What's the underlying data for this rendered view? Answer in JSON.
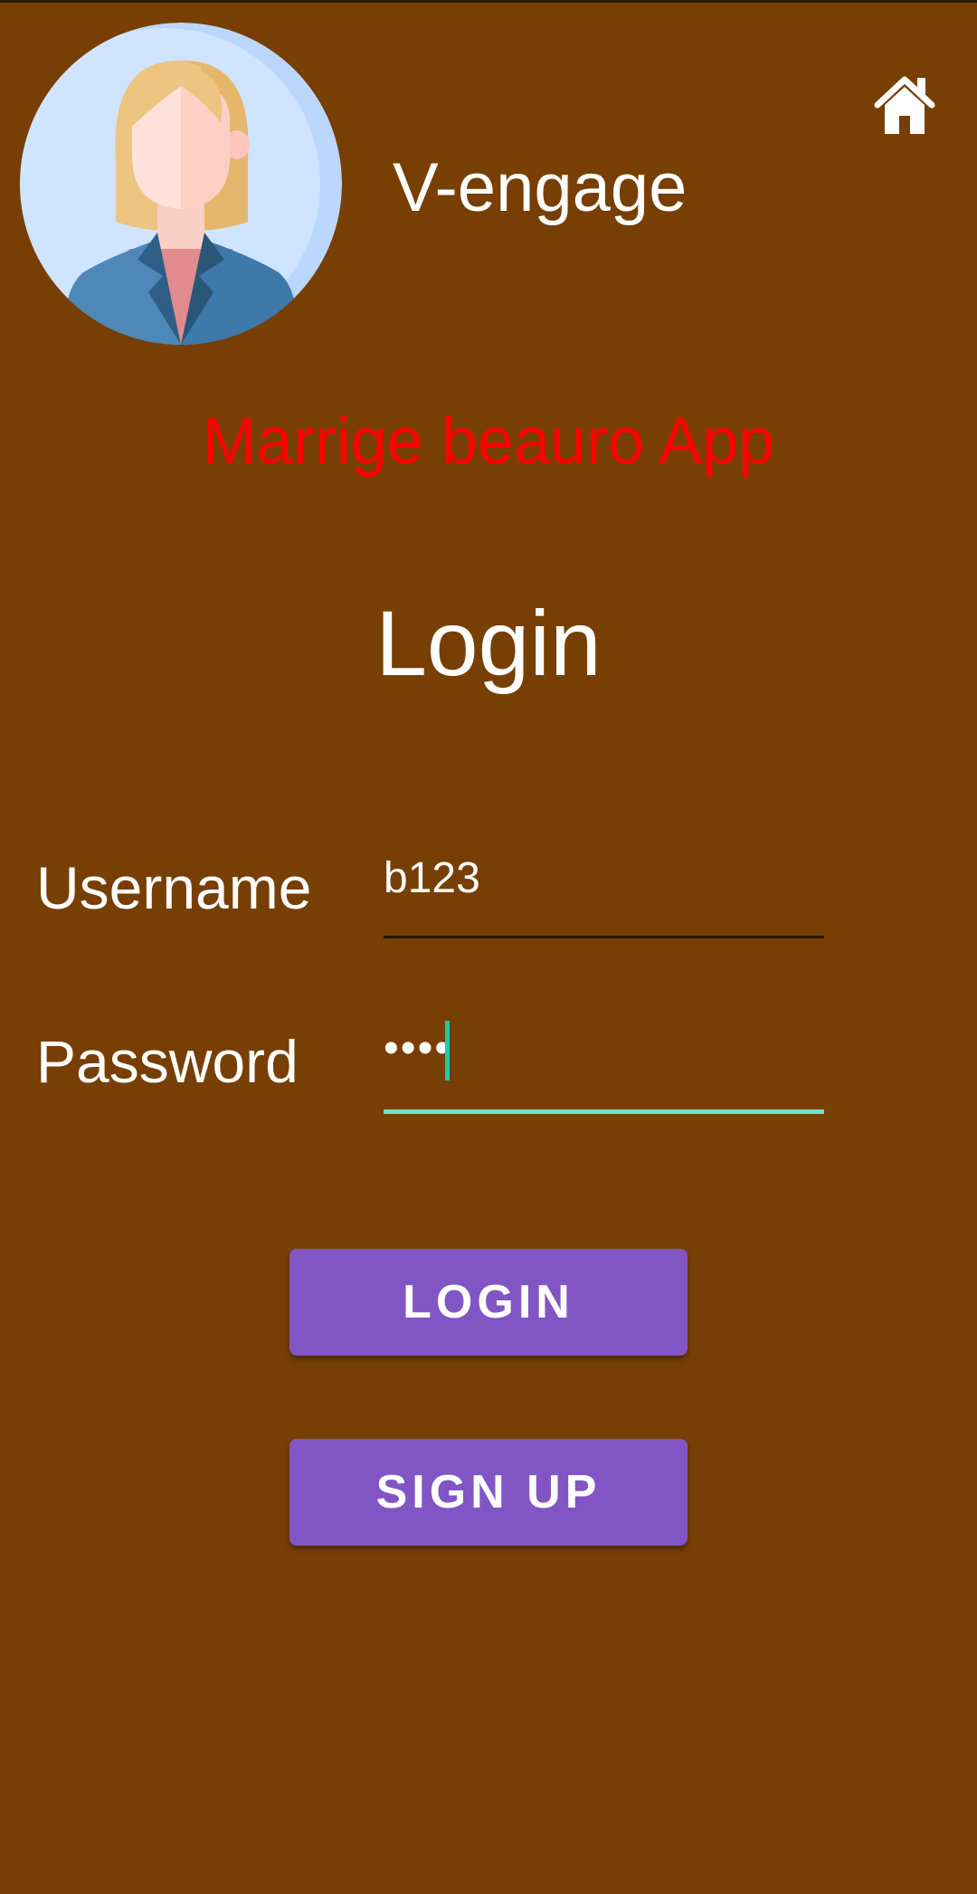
{
  "header": {
    "app_name": "V-engage",
    "avatar_icon": "businesswoman-avatar-icon",
    "home_icon": "home-icon"
  },
  "main": {
    "subtitle": "Marrige beauro App",
    "heading": "Login",
    "username": {
      "label": "Username",
      "value": "b123"
    },
    "password": {
      "label": "Password",
      "value": "••••"
    },
    "login_button": "LOGIN",
    "signup_button": "SIGN UP"
  },
  "colors": {
    "background": "#773F03",
    "subtitle": "#FF0000",
    "button": "#8156C4",
    "focus_accent": "#6FE3C2"
  }
}
